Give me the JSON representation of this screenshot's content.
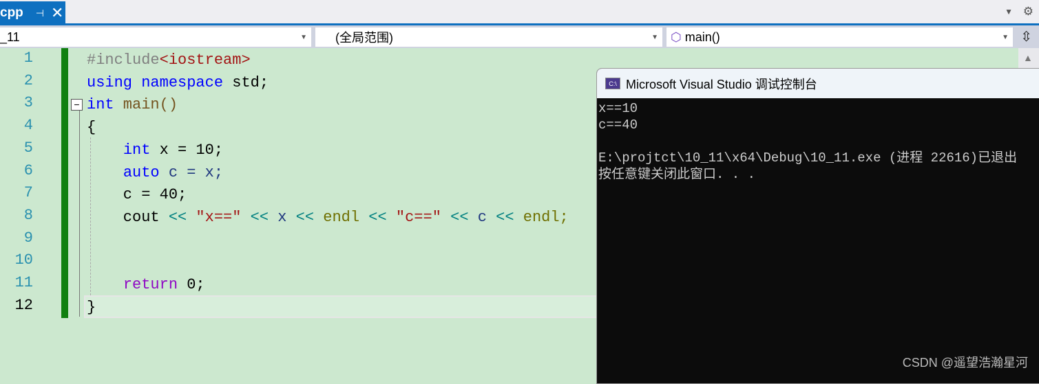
{
  "tab": {
    "label": "cpp",
    "pin": "⊣",
    "close": "✕"
  },
  "nav": {
    "project": "_11",
    "scope": "(全局范围)",
    "member": "main()"
  },
  "line_numbers": [
    "1",
    "2",
    "3",
    "4",
    "5",
    "6",
    "7",
    "8",
    "9",
    "10",
    "11",
    "12"
  ],
  "code": [
    [
      {
        "t": "#include",
        "c": "#808080"
      },
      {
        "t": "<iostream>",
        "c": "#a31515"
      }
    ],
    [
      {
        "t": "using",
        "c": "#0000ff"
      },
      {
        "t": " "
      },
      {
        "t": "namespace",
        "c": "#0000ff"
      },
      {
        "t": " std;",
        "c": "#000"
      }
    ],
    [
      {
        "t": "int",
        "c": "#0000ff"
      },
      {
        "t": " main()",
        "c": "#74531f"
      }
    ],
    [
      {
        "t": "{",
        "c": "#000"
      }
    ],
    [
      {
        "t": "    "
      },
      {
        "t": "int",
        "c": "#0000ff"
      },
      {
        "t": " x = 10;",
        "c": "#000"
      }
    ],
    [
      {
        "t": "    "
      },
      {
        "t": "auto",
        "c": "#0000ff"
      },
      {
        "t": " c = x;",
        "c": "#1f377f"
      }
    ],
    [
      {
        "t": "    c = 40;",
        "c": "#000"
      }
    ],
    [
      {
        "t": "    cout ",
        "c": "#000"
      },
      {
        "t": "<<",
        "c": "#008080"
      },
      {
        "t": " \"x==\" ",
        "c": "#a31515"
      },
      {
        "t": "<<",
        "c": "#008080"
      },
      {
        "t": " x ",
        "c": "#1f377f"
      },
      {
        "t": "<<",
        "c": "#008080"
      },
      {
        "t": " endl ",
        "c": "#6f6f00"
      },
      {
        "t": "<<",
        "c": "#008080"
      },
      {
        "t": " \"c==\" ",
        "c": "#a31515"
      },
      {
        "t": "<<",
        "c": "#008080"
      },
      {
        "t": " c ",
        "c": "#1f377f"
      },
      {
        "t": "<<",
        "c": "#008080"
      },
      {
        "t": " endl;",
        "c": "#6f6f00"
      }
    ],
    [
      {
        "t": ""
      }
    ],
    [
      {
        "t": ""
      }
    ],
    [
      {
        "t": "    "
      },
      {
        "t": "return",
        "c": "#8f08c4"
      },
      {
        "t": " 0;",
        "c": "#000"
      }
    ],
    [
      {
        "t": "}",
        "c": "#000"
      }
    ]
  ],
  "current_line": "12",
  "console": {
    "title": "Microsoft Visual Studio 调试控制台",
    "icon": "C:\\",
    "output": "x==10\nc==40\n\nE:\\projtct\\10_11\\x64\\Debug\\10_11.exe (进程 22616)已退出\n按任意键关闭此窗口. . ."
  },
  "watermark": "CSDN @遥望浩瀚星河"
}
